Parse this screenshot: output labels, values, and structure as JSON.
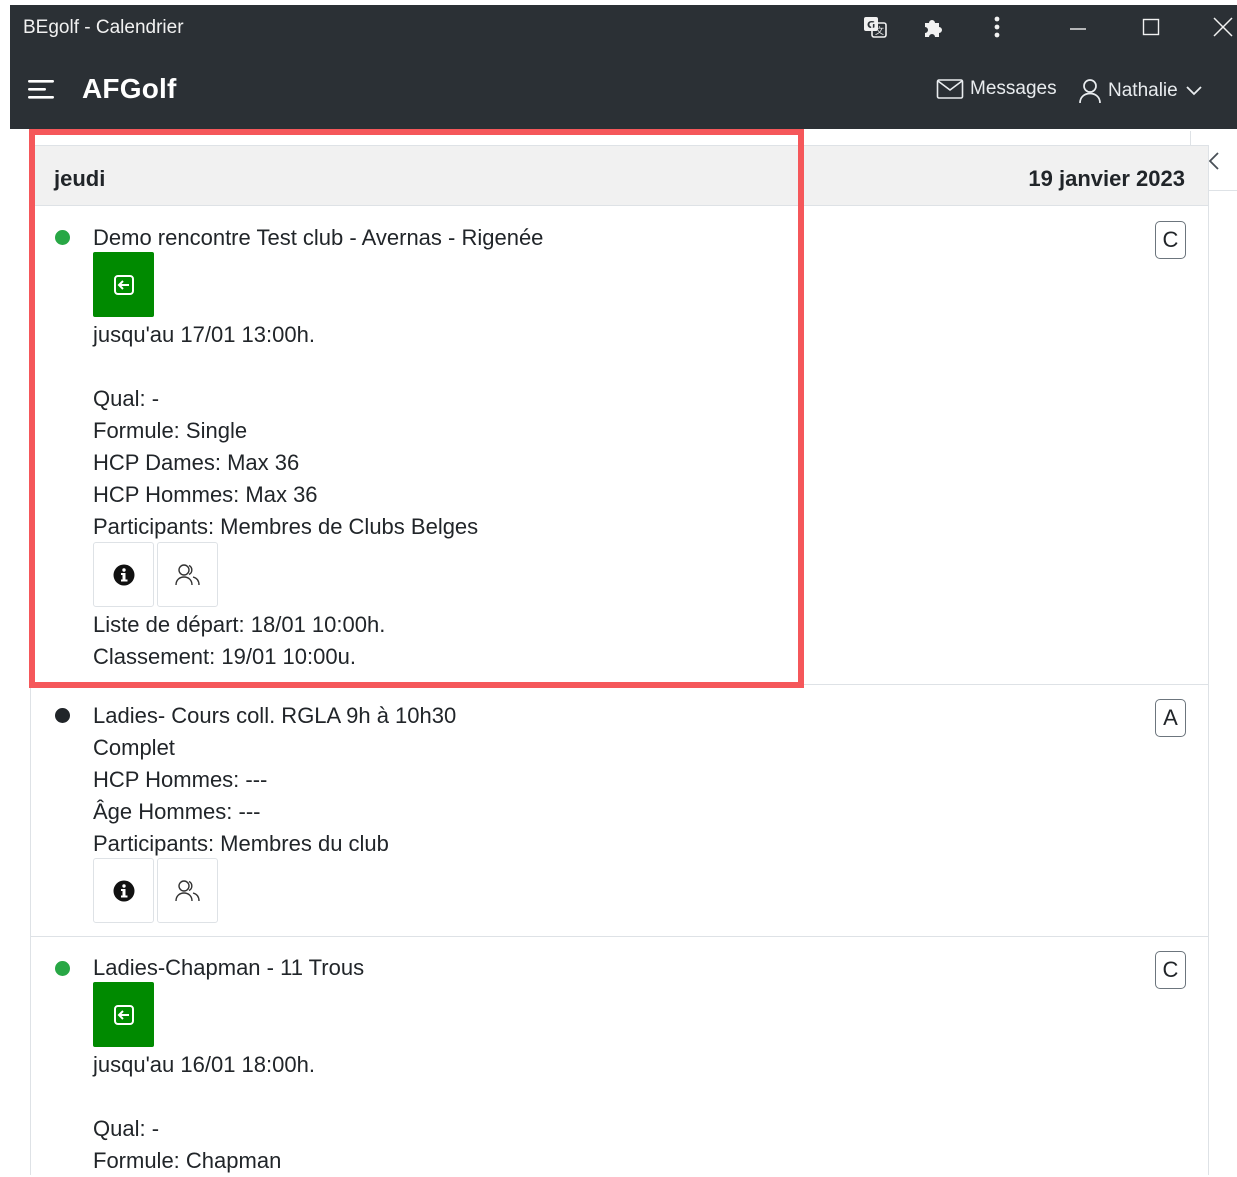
{
  "window": {
    "title": "BEgolf - Calendrier"
  },
  "navbar": {
    "brand": "AFGolf",
    "messages_label": "Messages",
    "user_name": "Nathalie"
  },
  "day": {
    "name": "jeudi",
    "date": "19 janvier 2023"
  },
  "events": [
    {
      "status_color": "#28a745",
      "title": "Demo rencontre Test club - Avernas - Rigenée",
      "badge": "C",
      "deadline": "jusqu'au 17/01 13:00h.",
      "details": [
        "Qual: -",
        "Formule: Single",
        "HCP Dames: Max 36",
        "HCP Hommes: Max 36",
        "Participants: Membres de Clubs Belges"
      ],
      "footer": [
        "Liste de départ: 18/01 10:00h.",
        "Classement: 19/01 10:00u."
      ]
    },
    {
      "status_color": "#212529",
      "title": "Ladies- Cours coll. RGLA 9h à 10h30",
      "badge": "A",
      "details": [
        "Complet",
        "HCP Hommes: ---",
        "Âge Hommes: ---",
        "Participants: Membres du club"
      ]
    },
    {
      "status_color": "#28a745",
      "title": "Ladies-Chapman - 11 Trous",
      "badge": "C",
      "deadline": "jusqu'au 16/01 18:00h.",
      "details": [
        "Qual: -",
        "Formule: Chapman"
      ]
    }
  ],
  "icons": {
    "translate": "translate-icon",
    "extensions": "puzzle-icon",
    "menu": "kebab-menu-icon",
    "minimize": "minimize-icon",
    "maximize": "maximize-icon",
    "close": "close-icon",
    "hamburger": "hamburger-icon",
    "mail": "mail-icon",
    "user": "user-icon",
    "chevron": "chevron-down-icon",
    "collapse": "chevron-left-icon",
    "enter": "sign-in-icon",
    "info": "info-icon",
    "participants": "users-icon"
  },
  "colors": {
    "navbar": "#2b3035",
    "register": "#008a00",
    "highlight": "#f5575a",
    "open": "#28a745"
  }
}
